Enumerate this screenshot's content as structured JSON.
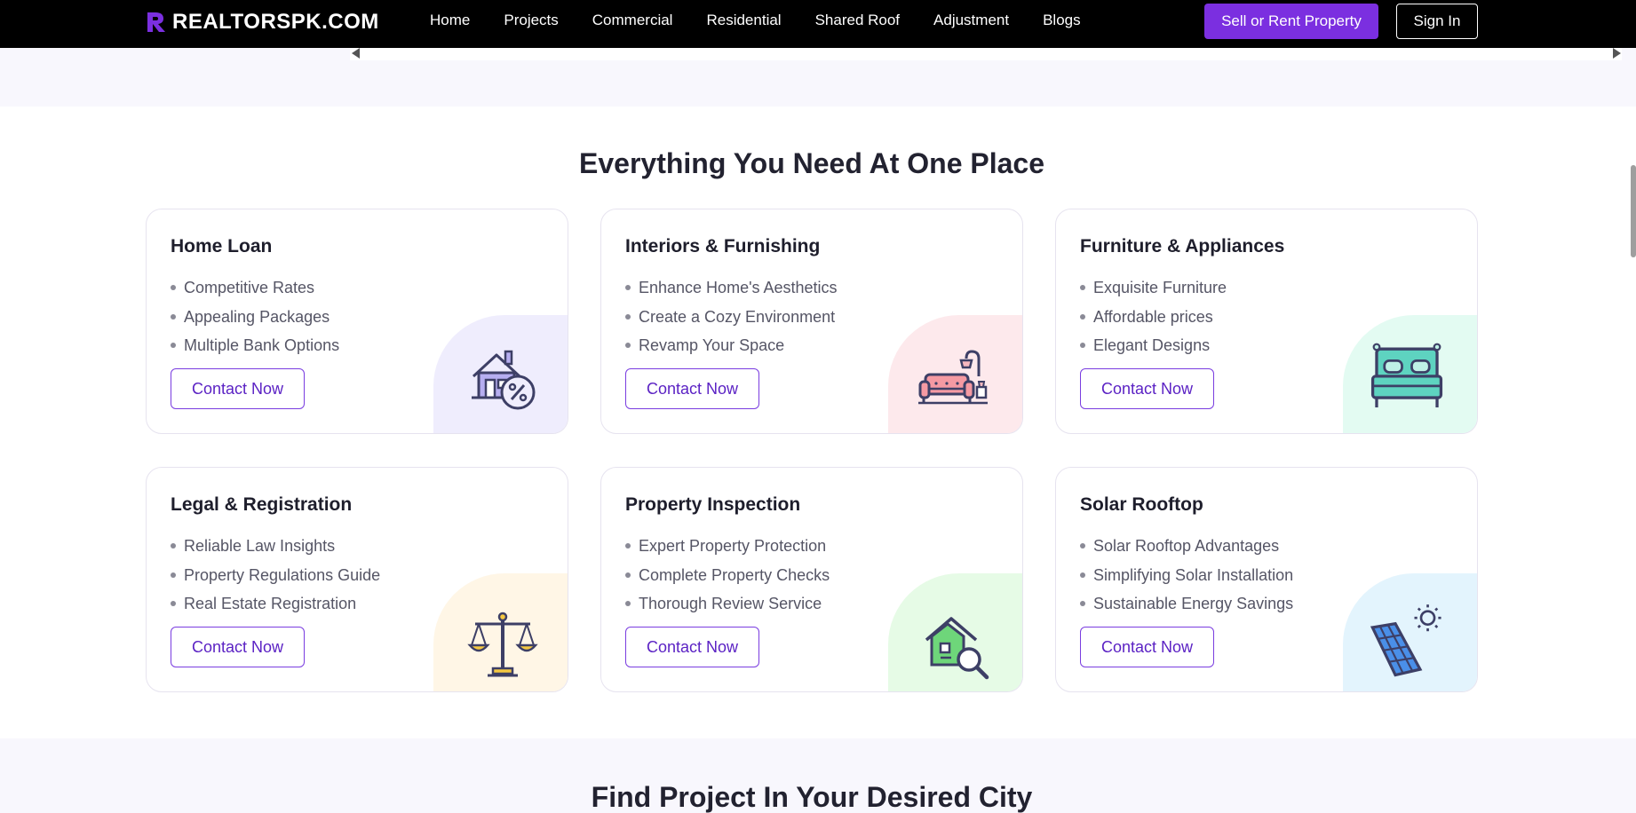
{
  "navbar": {
    "logo_text": "REALTORSPK.COM",
    "links": [
      "Home",
      "Projects",
      "Commercial",
      "Residential",
      "Shared Roof",
      "Adjustment",
      "Blogs"
    ],
    "sell_label": "Sell or Rent Property",
    "signin_label": "Sign In"
  },
  "section": {
    "title": "Everything You Need At One Place",
    "cards": [
      {
        "title": "Home Loan",
        "items": [
          "Competitive Rates",
          "Appealing Packages",
          "Multiple Bank Options"
        ],
        "button": "Contact Now",
        "icon": "home-loan-icon",
        "bg": "#efedfd"
      },
      {
        "title": "Interiors & Furnishing",
        "items": [
          "Enhance Home's Aesthetics",
          "Create a Cozy Environment",
          "Revamp Your Space"
        ],
        "button": "Contact Now",
        "icon": "sofa-icon",
        "bg": "#fde9ec"
      },
      {
        "title": "Furniture & Appliances",
        "items": [
          "Exquisite Furniture",
          "Affordable prices",
          "Elegant Designs"
        ],
        "button": "Contact Now",
        "icon": "bed-icon",
        "bg": "#e3fbf2"
      },
      {
        "title": "Legal & Registration",
        "items": [
          "Reliable Law Insights",
          "Property Regulations Guide",
          "Real Estate Registration"
        ],
        "button": "Contact Now",
        "icon": "scales-icon",
        "bg": "#fff6e6"
      },
      {
        "title": "Property Inspection",
        "items": [
          "Expert Property Protection",
          "Complete Property Checks",
          "Thorough Review Service"
        ],
        "button": "Contact Now",
        "icon": "house-search-icon",
        "bg": "#e6fbe6"
      },
      {
        "title": "Solar Rooftop",
        "items": [
          "Solar Rooftop Advantages",
          "Simplifying Solar Installation",
          "Sustainable Energy Savings"
        ],
        "button": "Contact Now",
        "icon": "solar-panel-icon",
        "bg": "#e3f4fd"
      }
    ]
  },
  "next_section": {
    "title": "Find Project In Your Desired City"
  },
  "colors": {
    "accent": "#7b2fe0",
    "nav_bg": "#000000"
  }
}
